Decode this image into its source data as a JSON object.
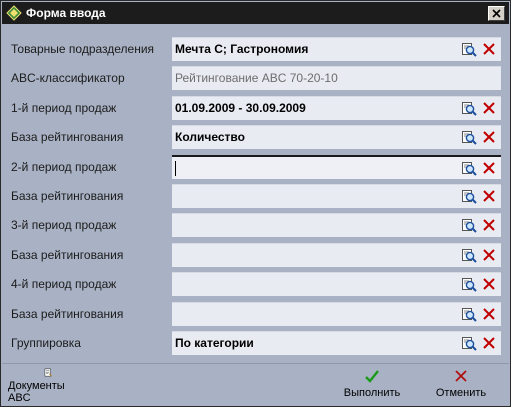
{
  "window": {
    "title": "Форма ввода"
  },
  "rows": [
    {
      "label": "Товарные подразделения",
      "value": "Мечта С; Гастрономия",
      "readonly": false,
      "active": false,
      "buttons": true
    },
    {
      "label": "ABC-классификатор",
      "value": "Рейтингование ABC 70-20-10",
      "readonly": true,
      "active": false,
      "buttons": false
    },
    {
      "label": "1-й период продаж",
      "value": "01.09.2009 - 30.09.2009",
      "readonly": false,
      "active": false,
      "buttons": true
    },
    {
      "label": "База рейтингования",
      "value": "Количество",
      "readonly": false,
      "active": false,
      "buttons": true
    },
    {
      "label": "2-й период продаж",
      "value": "",
      "readonly": false,
      "active": true,
      "buttons": true
    },
    {
      "label": "База рейтингования",
      "value": "",
      "readonly": false,
      "active": false,
      "buttons": true
    },
    {
      "label": "3-й период продаж",
      "value": "",
      "readonly": false,
      "active": false,
      "buttons": true
    },
    {
      "label": "База рейтингования",
      "value": "",
      "readonly": false,
      "active": false,
      "buttons": true
    },
    {
      "label": "4-й период продаж",
      "value": "",
      "readonly": false,
      "active": false,
      "buttons": true
    },
    {
      "label": "База рейтингования",
      "value": "",
      "readonly": false,
      "active": false,
      "buttons": true
    },
    {
      "label": "Группировка",
      "value": "По категории",
      "readonly": false,
      "active": false,
      "buttons": true
    }
  ],
  "toolbar": {
    "abc_docs_label": "Документы ABC",
    "execute_label": "Выполнить",
    "cancel_label": "Отменить"
  },
  "colors": {
    "window_bg": "#a9b2c4",
    "field_bg": "#e9ebf3",
    "titlebar_bg": "#1c1c1c",
    "clear_icon": "#c00000",
    "execute_icon": "#1a9a1a"
  },
  "icons": {
    "app": "app-diamond-icon",
    "lookup": "magnifier-icon",
    "clear": "red-x-icon",
    "abc_docs": "document-icon",
    "execute": "checkmark-icon",
    "cancel": "cross-icon"
  }
}
